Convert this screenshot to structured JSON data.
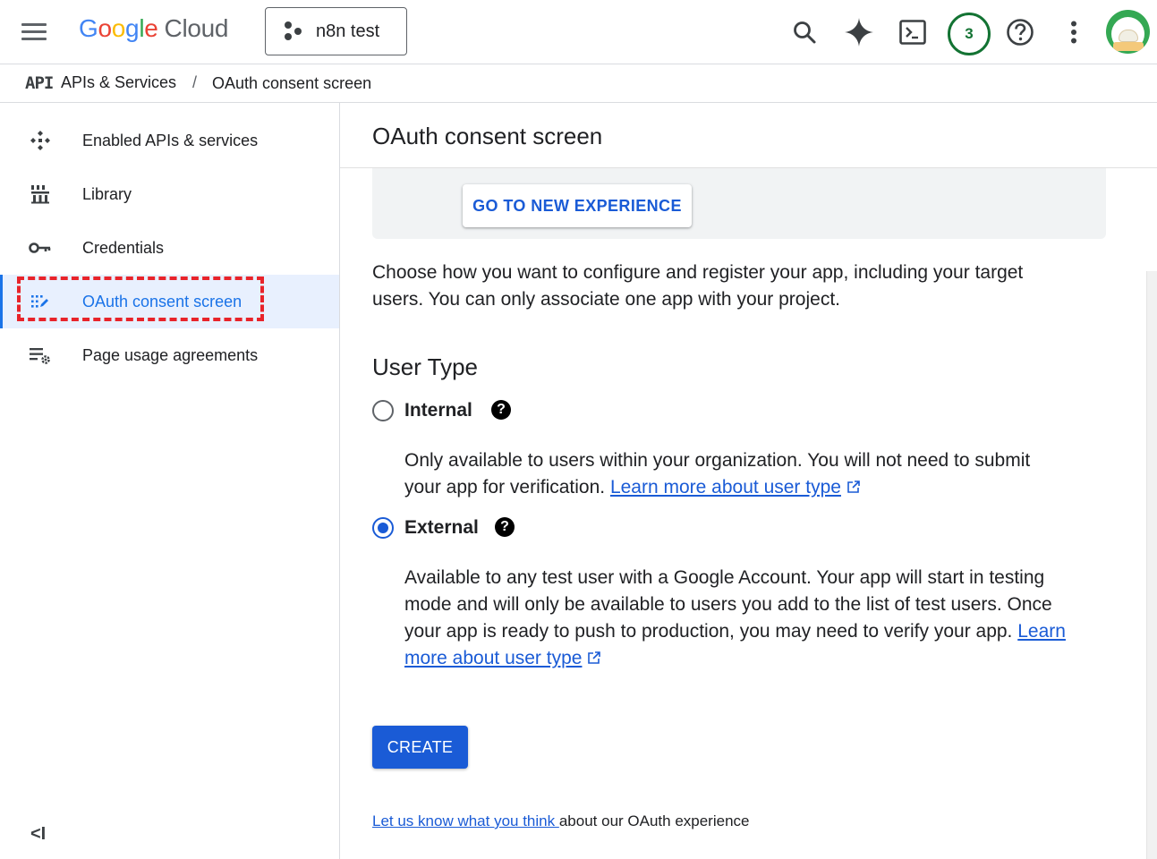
{
  "header": {
    "logo_google": [
      "G",
      "o",
      "o",
      "g",
      "l",
      "e"
    ],
    "logo_cloud": "Cloud",
    "project": "n8n test",
    "notifications_count": "3",
    "icons": [
      "menu-icon",
      "search-icon",
      "gemini-sparkle-icon",
      "cloud-shell-icon",
      "help-icon",
      "more-vert-icon"
    ]
  },
  "breadcrumb": {
    "badge": "API",
    "section": "APIs & Services",
    "separator": "/",
    "page": "OAuth consent screen"
  },
  "sidebar": {
    "items": [
      {
        "label": "Enabled APIs & services",
        "icon": "api-hub-icon",
        "active": false
      },
      {
        "label": "Library",
        "icon": "library-icon",
        "active": false
      },
      {
        "label": "Credentials",
        "icon": "key-icon",
        "active": false
      },
      {
        "label": "OAuth consent screen",
        "icon": "consent-grid-icon",
        "active": true
      },
      {
        "label": "Page usage agreements",
        "icon": "settings-list-icon",
        "active": false
      }
    ],
    "collapse_label": "<I"
  },
  "main": {
    "title": "OAuth consent screen",
    "banner_button": "GO TO NEW EXPERIENCE",
    "description": "Choose how you want to configure and register your app, including your target users. You can only associate one app with your project.",
    "user_type_title": "User Type",
    "options": [
      {
        "label": "Internal",
        "checked": false,
        "description": "Only available to users within your organization. You will not need to submit your app for verification. ",
        "link": "Learn more about user type"
      },
      {
        "label": "External",
        "checked": true,
        "description": "Available to any test user with a Google Account. Your app will start in testing mode and will only be available to users you add to the list of test users. Once your app is ready to push to production, you may need to verify your app. ",
        "link": "Learn more about user type"
      }
    ],
    "create_button": "CREATE",
    "feedback_link": "Let us know what you think ",
    "feedback_text": "about our OAuth experience"
  },
  "colors": {
    "accent": "#1a5bd6",
    "active_nav_bg": "#e8f0fe",
    "highlight_dashed": "#e8232a",
    "notification_ring": "#137333"
  }
}
